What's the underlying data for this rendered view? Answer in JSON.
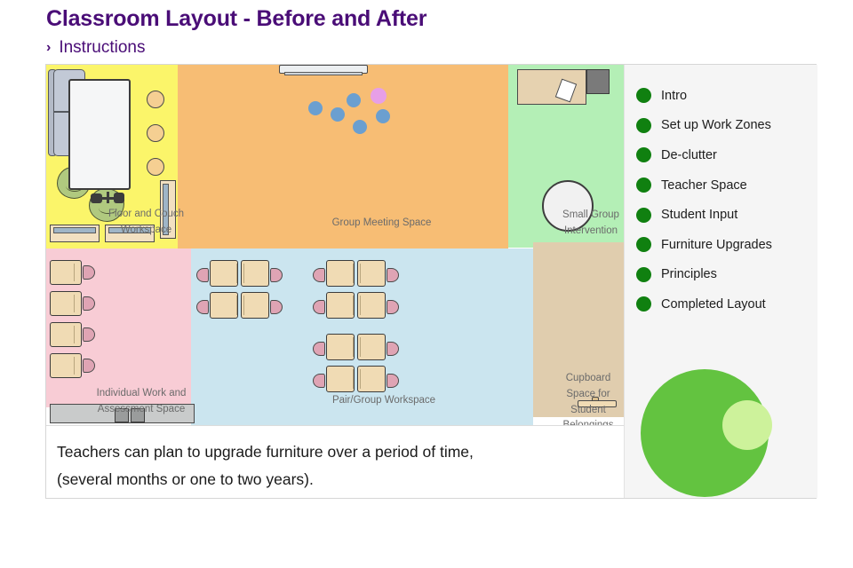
{
  "header": {
    "title": "Classroom Layout - Before and After",
    "breadcrumb_chevron": "›",
    "breadcrumb_label": "Instructions",
    "title_color": "#4a0d77"
  },
  "sidebar": {
    "bullet_color": "#108010",
    "items": [
      {
        "label": "Intro"
      },
      {
        "label": "Set up Work Zones"
      },
      {
        "label": "De-clutter"
      },
      {
        "label": "Teacher Space"
      },
      {
        "label": "Student Input"
      },
      {
        "label": "Furniture Upgrades"
      },
      {
        "label": "Principles"
      },
      {
        "label": "Completed Layout"
      }
    ],
    "graphic": {
      "big_circle_color": "#63c340",
      "small_circle_color": "#cdf29b"
    }
  },
  "caption": {
    "line1": "Teachers can plan to upgrade furniture over a period of time,",
    "line2": "(several months or one to two years)."
  },
  "floorplan": {
    "zones": [
      {
        "name": "floor-and-couch",
        "label": "Floor and Couch\nWorkspace",
        "color": "#fbf56a"
      },
      {
        "name": "group-meeting",
        "label": "Group Meeting Space",
        "color": "#f7bd74"
      },
      {
        "name": "small-group",
        "label": "Small Group\nIntervention",
        "color": "#b4efb6"
      },
      {
        "name": "individual-work",
        "label": "Individual Work and\nAssessment Space",
        "color": "#f8ccd5"
      },
      {
        "name": "pair-group",
        "label": "Pair/Group Workspace",
        "color": "#cbe5ef"
      },
      {
        "name": "cupboard",
        "label": "Cupboard\nSpace for\nStudent\nBelongings",
        "color": "#e0cdae"
      }
    ],
    "meeting_dots": {
      "blue_color": "#6b9fd0",
      "pink_color": "#e79fe7",
      "blue_count": 5,
      "pink_count": 1
    }
  }
}
